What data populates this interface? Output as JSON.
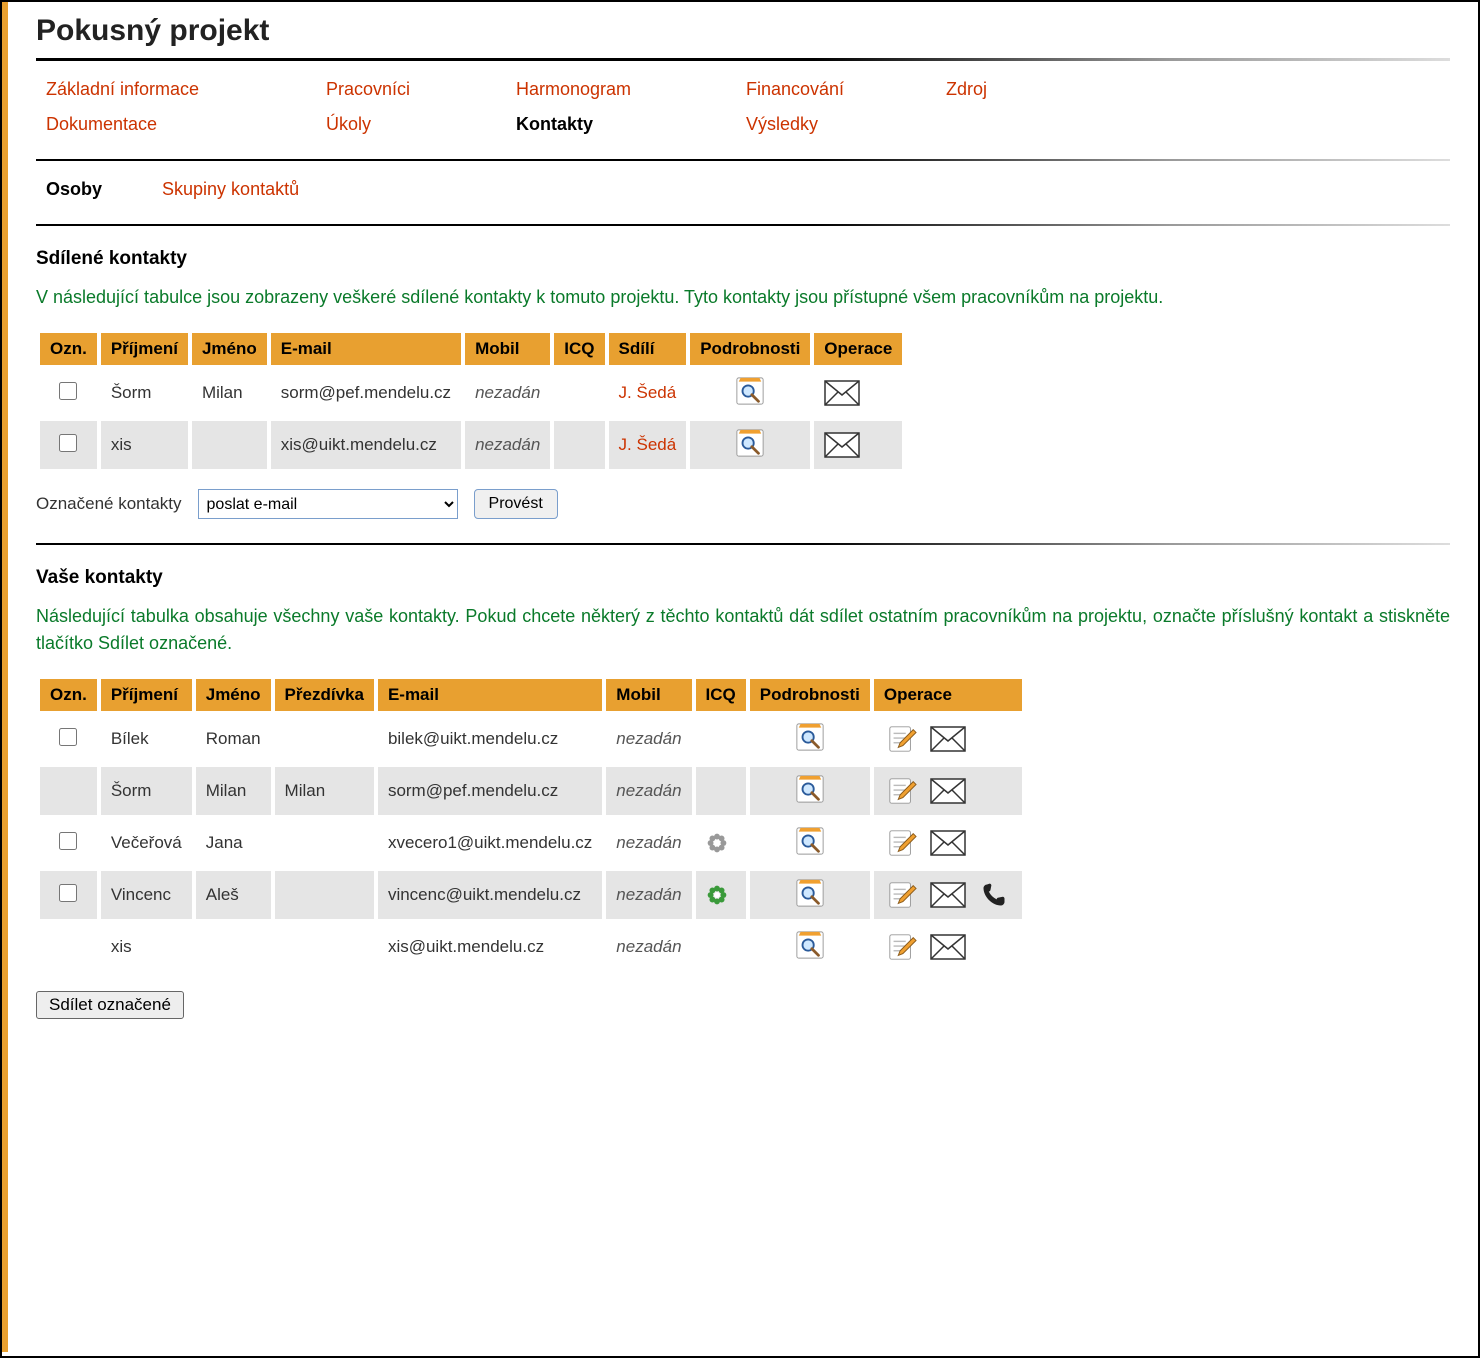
{
  "title": "Pokusný projekt",
  "nav": {
    "row1": [
      "Základní informace",
      "Pracovníci",
      "Harmonogram",
      "Financování",
      "Zdroj"
    ],
    "row2": [
      "Dokumentace",
      "Úkoly",
      "Kontakty",
      "Výsledky",
      ""
    ]
  },
  "active_nav": "Kontakty",
  "subnav": {
    "osoby": "Osoby",
    "skupiny": "Skupiny kontaktů"
  },
  "shared": {
    "heading": "Sdílené kontakty",
    "desc": "V následující tabulce jsou zobrazeny veškeré sdílené kontakty k tomuto projektu. Tyto kontakty jsou přístupné všem pracovníkům na projektu.",
    "headers": [
      "Ozn.",
      "Příjmení",
      "Jméno",
      "E-mail",
      "Mobil",
      "ICQ",
      "Sdílí",
      "Podrobnosti",
      "Operace"
    ],
    "rows": [
      {
        "prijmeni": "Šorm",
        "jmeno": "Milan",
        "email": "sorm@pef.mendelu.cz",
        "mobil": "nezadán",
        "icq": "",
        "sdili": "J. Šedá"
      },
      {
        "prijmeni": "xis",
        "jmeno": "",
        "email": "xis@uikt.mendelu.cz",
        "mobil": "nezadán",
        "icq": "",
        "sdili": "J. Šedá"
      }
    ],
    "action_label": "Označené kontakty",
    "select_value": "poslat e-mail",
    "execute_label": "Provést"
  },
  "own": {
    "heading": "Vaše kontakty",
    "desc": "Následující tabulka obsahuje všechny vaše kontakty. Pokud chcete některý z těchto kontaktů dát sdílet ostatním pracovníkům na projektu, označte příslušný kontakt a stiskněte tlačítko Sdílet označené.",
    "headers": [
      "Ozn.",
      "Příjmení",
      "Jméno",
      "Přezdívka",
      "E-mail",
      "Mobil",
      "ICQ",
      "Podrobnosti",
      "Operace"
    ],
    "rows": [
      {
        "cb": true,
        "prijmeni": "Bílek",
        "jmeno": "Roman",
        "prezdivka": "",
        "email": "bilek@uikt.mendelu.cz",
        "mobil": "nezadán",
        "icq": "",
        "phone": false
      },
      {
        "cb": false,
        "prijmeni": "Šorm",
        "jmeno": "Milan",
        "prezdivka": "Milan",
        "email": "sorm@pef.mendelu.cz",
        "mobil": "nezadán",
        "icq": "",
        "phone": false
      },
      {
        "cb": true,
        "prijmeni": "Večeřová",
        "jmeno": "Jana",
        "prezdivka": "",
        "email": "xvecero1@uikt.mendelu.cz",
        "mobil": "nezadán",
        "icq": "gray",
        "phone": false
      },
      {
        "cb": true,
        "prijmeni": "Vincenc",
        "jmeno": "Aleš",
        "prezdivka": "",
        "email": "vincenc@uikt.mendelu.cz",
        "mobil": "nezadán",
        "icq": "green",
        "phone": true
      },
      {
        "cb": false,
        "prijmeni": "xis",
        "jmeno": "",
        "prezdivka": "",
        "email": "xis@uikt.mendelu.cz",
        "mobil": "nezadán",
        "icq": "",
        "phone": false
      }
    ],
    "share_button": "Sdílet označené"
  }
}
